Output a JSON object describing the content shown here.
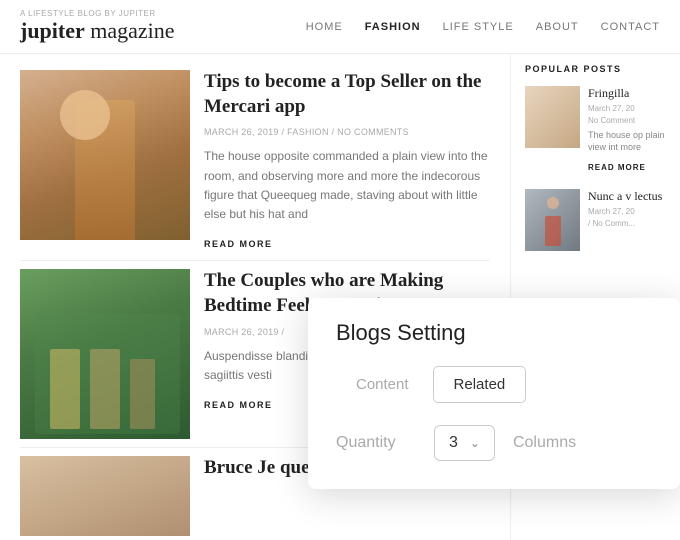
{
  "header": {
    "tagline": "A LIFESTYLE BLOG BY JUPITER",
    "logo_bold": "jupiter",
    "logo_thin": " magazine",
    "nav": [
      {
        "label": "HOME",
        "active": false
      },
      {
        "label": "FASHION",
        "active": true
      },
      {
        "label": "LIFE STYLE",
        "active": false
      },
      {
        "label": "ABOUT",
        "active": false
      },
      {
        "label": "CONTACT",
        "active": false
      }
    ]
  },
  "articles": [
    {
      "title": "Tips to become a Top Seller on the Mercari app",
      "meta": "MARCH 26, 2019 / FASHION / NO COMMENTS",
      "excerpt": "The house opposite commanded a plain view into the room, and observing more and more the indecorous figure that Queequeg made, staving about with little else but his hat and",
      "read_more": "READ MORE"
    },
    {
      "title": "The Couples who are Making Bedtime Feel Fantastic",
      "meta": "MARCH 26, 2019 /",
      "excerpt": "Auspendisse blandit quis quam vel accum massa sagiittis vesti",
      "read_more": "READ MORE"
    },
    {
      "title": "Bruce Je question medi",
      "meta": "",
      "excerpt": "",
      "read_more": ""
    }
  ],
  "sidebar": {
    "title": "POPULAR POSTS",
    "posts": [
      {
        "title": "Fringilla",
        "meta": "March 27, 20\nNo Comment",
        "excerpt": "The house op plain view int more",
        "read_more": "READ MORE"
      },
      {
        "title": "Nunc a v lectus",
        "meta": "March 27, 20\n/ No Comm...",
        "excerpt": "",
        "read_more": ""
      }
    ]
  },
  "modal": {
    "title": "Blogs Setting",
    "tabs": [
      {
        "label": "Content",
        "active": false
      },
      {
        "label": "Related",
        "active": true
      }
    ],
    "row_label": "Quantity",
    "select_value": "3",
    "col_label": "Columns"
  }
}
